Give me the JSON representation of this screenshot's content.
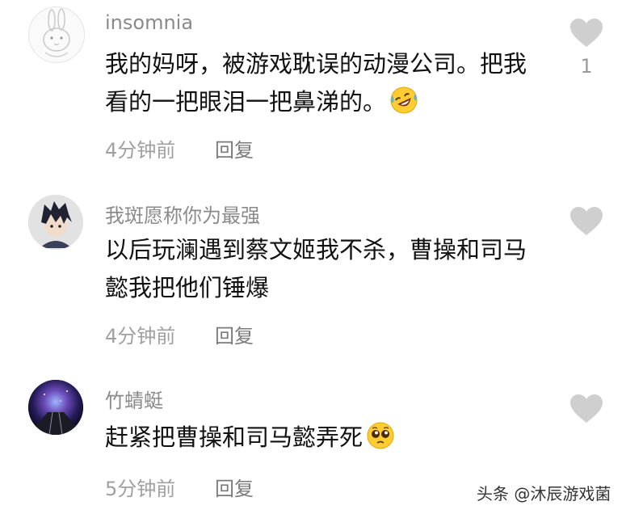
{
  "comments": [
    {
      "username": "insomnia",
      "text": "我的妈呀，被游戏耽误的动漫公司。把我看的一把眼泪一把鼻涕的。",
      "emoji": "rolling-on-floor-laughing",
      "time": "4分钟前",
      "reply_label": "回复",
      "like_count": "1",
      "avatar": "rabbit-avatar"
    },
    {
      "username": "我斑愿称你为最强",
      "text": "以后玩澜遇到蔡文姬我不杀，曹操和司马懿我把他们锤爆",
      "time": "4分钟前",
      "reply_label": "回复",
      "like_count": "",
      "avatar": "anime-boy-avatar"
    },
    {
      "username": "竹蜻蜓",
      "text": "赶紧把曹操和司马懿弄死",
      "emoji": "pleading-face",
      "time": "5分钟前",
      "reply_label": "回复",
      "like_count": "",
      "avatar": "galaxy-tunnel-avatar"
    }
  ],
  "watermark": "头条 @沐辰游戏菌",
  "colors": {
    "username": "#8a8a8a",
    "body_text": "#111111",
    "meta": "#a0a0a0",
    "heart": "#cfcfcf"
  }
}
